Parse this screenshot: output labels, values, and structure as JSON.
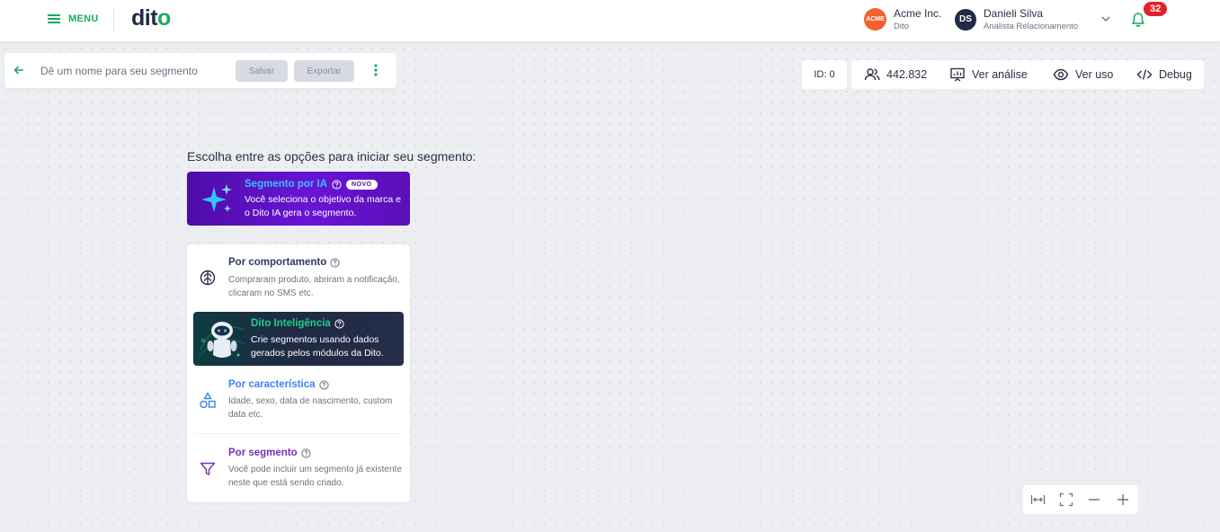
{
  "header": {
    "menu_label": "MENU",
    "logo_text": "dit",
    "logo_suffix": "o",
    "company": {
      "badge": "ACME",
      "name": "Acme Inc.",
      "sub": "Dito"
    },
    "user": {
      "initials": "DS",
      "name": "Danieli Silva",
      "role": "Analista Relacionamento"
    },
    "notifications": "32"
  },
  "segment_bar": {
    "name_placeholder": "Dê um nome para seu segmento",
    "save_label": "Salvar",
    "export_label": "Exportar"
  },
  "toolbar": {
    "id_label": "ID: 0",
    "audience_count": "442.832",
    "analysis_label": "Ver análise",
    "usage_label": "Ver uso",
    "debug_label": "Debug"
  },
  "main": {
    "prompt": "Escolha entre as opções para iniciar seu segmento:",
    "ia_card": {
      "title": "Segmento por IA",
      "badge": "NOVO",
      "description": "Você seleciona o objetivo da marca e o Dito IA gera o segmento."
    },
    "options": {
      "behavior": {
        "title": "Por comportamento",
        "description": "Compraram produto, abriram a notificação, clicaram no SMS etc."
      },
      "dito_intelligence": {
        "title": "Dito Inteligência",
        "description": "Crie segmentos usando dados gerados pelos módulos da Dito."
      },
      "characteristic": {
        "title": "Por característica",
        "description": "Idade, sexo, data de nascimento, custom data etc."
      },
      "segment": {
        "title": "Por segmento",
        "description": "Você pode incluir um segmento já existente neste que está sendo criado."
      }
    }
  },
  "colors": {
    "brand_green": "#1aab5f",
    "navy": "#1f2a44",
    "ia_purple": "#5a0fb8",
    "ia_title": "#35c3ff",
    "notif_red": "#e5202b",
    "characteristic_blue": "#3b82f6",
    "segment_purple": "#7a2fb5"
  }
}
